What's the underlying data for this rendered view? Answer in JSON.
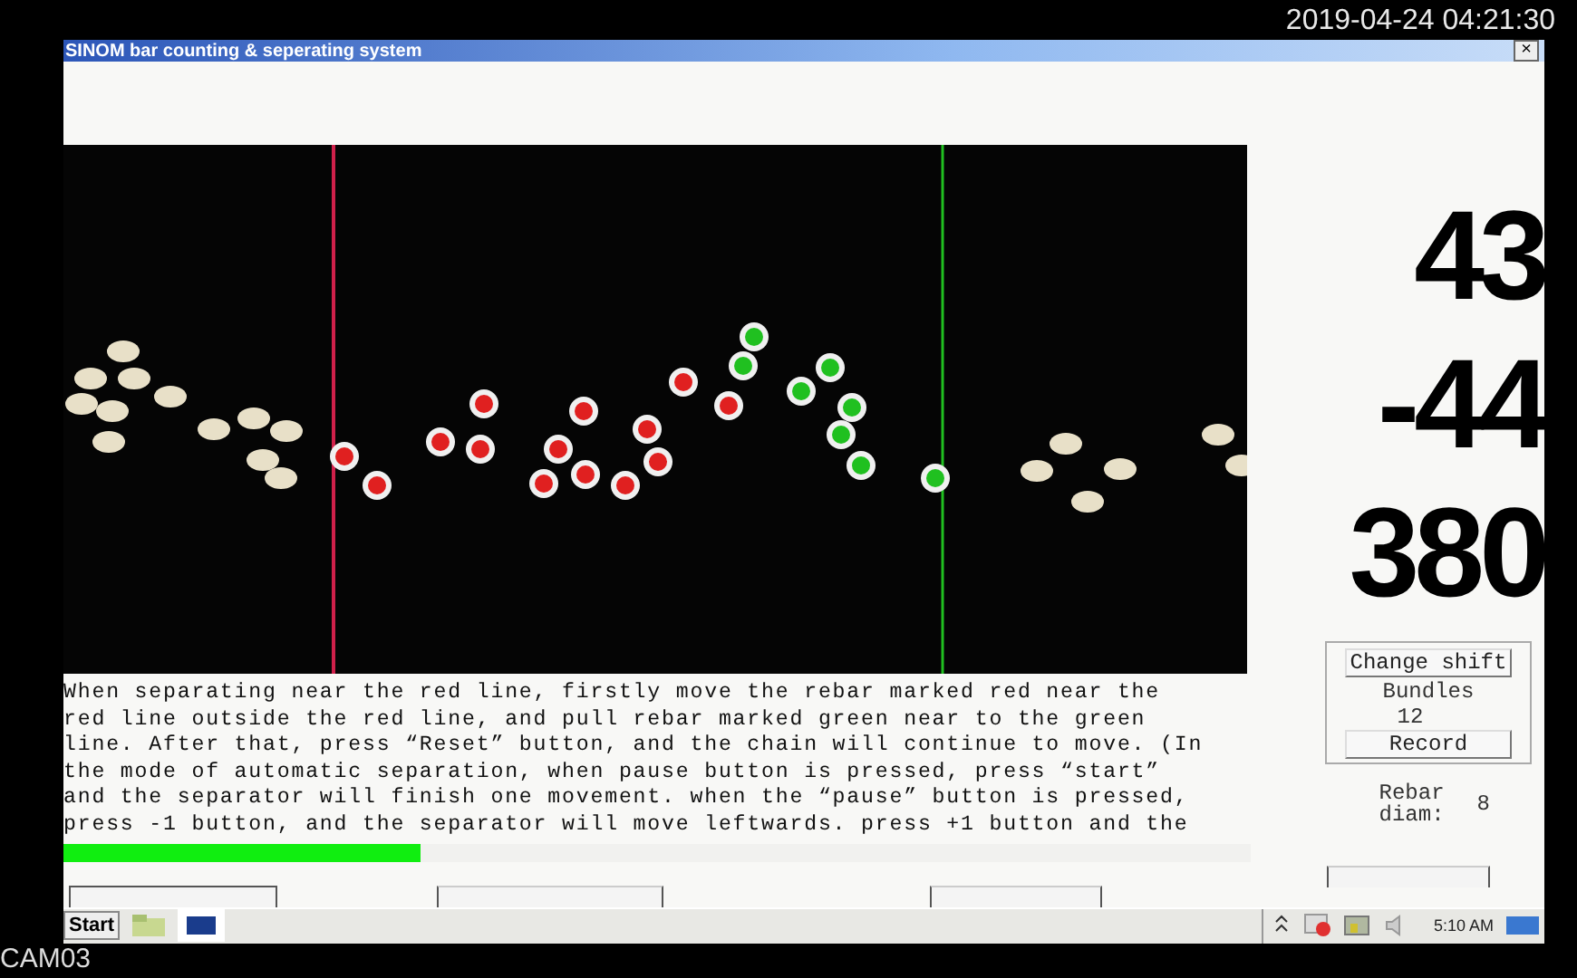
{
  "camera_overlay": {
    "timestamp": "2019-04-24 04:21:30",
    "camera_name": "CAM03"
  },
  "window": {
    "title": "SINOM bar counting & seperating system",
    "close_glyph": "×"
  },
  "readouts": [
    "43",
    "-44",
    "380"
  ],
  "instructions": "When separating near the red line, firstly move the rebar marked red near the\nred line outside the red line, and pull rebar marked green near to the green\nline. After that, press “Reset” button, and the chain will continue to move. (In\nthe mode of automatic separation, when pause button is pressed, press “start”\nand the separator will finish one movement. when the “pause” button is pressed,\npress -1 button, and the separator will move leftwards. press +1 button and the",
  "progress": {
    "level": 0.3
  },
  "shift_panel": {
    "change_shift": "Change shift",
    "bundles_label": "Bundles",
    "bundles_value": "12",
    "record": "Record"
  },
  "rebar_diam": {
    "label": "Rebar\ndiam:",
    "value": "8"
  },
  "taskbar": {
    "start": "Start",
    "clock": "5:10 AM"
  }
}
